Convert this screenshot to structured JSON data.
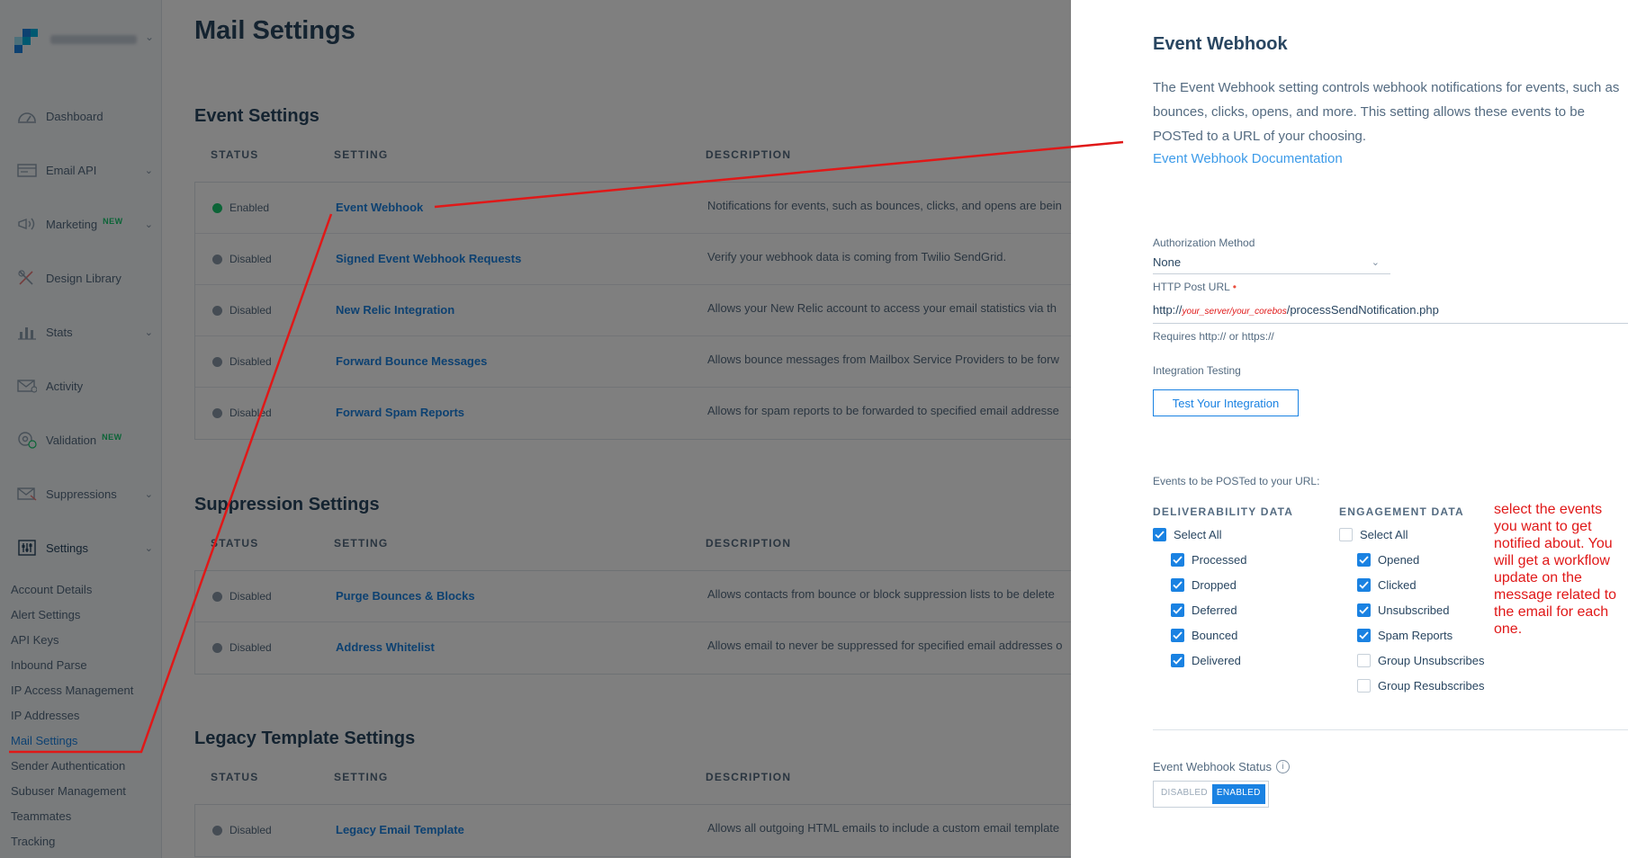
{
  "colors": {
    "accent": "#1a82e2",
    "enabled": "#18c96e",
    "annotation": "#e01818",
    "text": "#294661"
  },
  "sidebar": {
    "account_chevron": "⌄",
    "nav": [
      {
        "label": "Dashboard",
        "icon": "dashboard-icon",
        "new": "",
        "chevron": ""
      },
      {
        "label": "Email API",
        "icon": "email-api-icon",
        "new": "",
        "chevron": "⌄"
      },
      {
        "label": "Marketing",
        "icon": "marketing-megaphone-icon",
        "new": "NEW",
        "chevron": "⌄"
      },
      {
        "label": "Design Library",
        "icon": "design-library-icon",
        "new": "",
        "chevron": ""
      },
      {
        "label": "Stats",
        "icon": "stats-bar-icon",
        "new": "",
        "chevron": "⌄"
      },
      {
        "label": "Activity",
        "icon": "activity-mail-icon",
        "new": "",
        "chevron": ""
      },
      {
        "label": "Validation",
        "icon": "validation-at-icon",
        "new": "NEW",
        "chevron": ""
      },
      {
        "label": "Suppressions",
        "icon": "suppressions-mail-icon",
        "new": "",
        "chevron": "⌄"
      },
      {
        "label": "Settings",
        "icon": "settings-sliders-icon",
        "new": "",
        "chevron": "⌄"
      }
    ],
    "sub": [
      "Account Details",
      "Alert Settings",
      "API Keys",
      "Inbound Parse",
      "IP Access Management",
      "IP Addresses",
      "Mail Settings",
      "Sender Authentication",
      "Subuser Management",
      "Teammates",
      "Tracking"
    ]
  },
  "main": {
    "title": "Mail Settings",
    "headers": {
      "status": "STATUS",
      "setting": "SETTING",
      "description": "DESCRIPTION"
    },
    "sections": [
      {
        "title": "Event Settings",
        "rows": [
          {
            "status": "Enabled",
            "setting": "Event Webhook",
            "description": "Notifications for events, such as bounces, clicks, and opens are bein"
          },
          {
            "status": "Disabled",
            "setting": "Signed Event Webhook Requests",
            "description": "Verify your webhook data is coming from Twilio SendGrid."
          },
          {
            "status": "Disabled",
            "setting": "New Relic Integration",
            "description": "Allows your New Relic account to access your email statistics via th"
          },
          {
            "status": "Disabled",
            "setting": "Forward Bounce Messages",
            "description": "Allows bounce messages from Mailbox Service Providers to be forw"
          },
          {
            "status": "Disabled",
            "setting": "Forward Spam Reports",
            "description": "Allows for spam reports to be forwarded to specified email addresse"
          }
        ]
      },
      {
        "title": "Suppression Settings",
        "rows": [
          {
            "status": "Disabled",
            "setting": "Purge Bounces & Blocks",
            "description": "Allows contacts from bounce or block suppression lists to be delete"
          },
          {
            "status": "Disabled",
            "setting": "Address Whitelist",
            "description": "Allows email to never be suppressed for specified email addresses o"
          }
        ]
      },
      {
        "title": "Legacy Template Settings",
        "rows": [
          {
            "status": "Disabled",
            "setting": "Legacy Email Template",
            "description": "Allows all outgoing HTML emails to include a custom email template"
          }
        ]
      }
    ]
  },
  "drawer": {
    "title": "Event Webhook",
    "description": "The Event Webhook setting controls webhook notifications for events, such as bounces, clicks, opens, and more. This setting allows these events to be POSTed to a URL of your choosing.",
    "doc_link": "Event Webhook Documentation",
    "auth_label": "Authorization Method",
    "auth_value": "None",
    "auth_chevron": "⌄",
    "url_label": "HTTP Post URL",
    "url_required": "•",
    "url_prefix": "http://",
    "url_annotation": "your_server/your_corebos",
    "url_suffix": "/processSendNotification.php",
    "url_hint": "Requires http:// or https://",
    "testing_label": "Integration Testing",
    "test_button": "Test Your Integration",
    "events_label": "Events to be POSTed to your URL:",
    "deliverability": {
      "header": "DELIVERABILITY DATA",
      "select_all": {
        "label": "Select All",
        "checked": true
      },
      "items": [
        {
          "label": "Processed",
          "checked": true
        },
        {
          "label": "Dropped",
          "checked": true
        },
        {
          "label": "Deferred",
          "checked": true
        },
        {
          "label": "Bounced",
          "checked": true
        },
        {
          "label": "Delivered",
          "checked": true
        }
      ]
    },
    "engagement": {
      "header": "ENGAGEMENT DATA",
      "select_all": {
        "label": "Select All",
        "checked": false
      },
      "items": [
        {
          "label": "Opened",
          "checked": true
        },
        {
          "label": "Clicked",
          "checked": true
        },
        {
          "label": "Unsubscribed",
          "checked": true
        },
        {
          "label": "Spam Reports",
          "checked": true
        },
        {
          "label": "Group Unsubscribes",
          "checked": false
        },
        {
          "label": "Group Resubscribes",
          "checked": false
        }
      ]
    },
    "status_label": "Event Webhook Status",
    "status_info_glyph": "i",
    "toggle": {
      "off": "DISABLED",
      "on": "ENABLED"
    },
    "annotation": "select the events you want to get notified about. You will get a workflow update on the message related to the email for each one."
  }
}
